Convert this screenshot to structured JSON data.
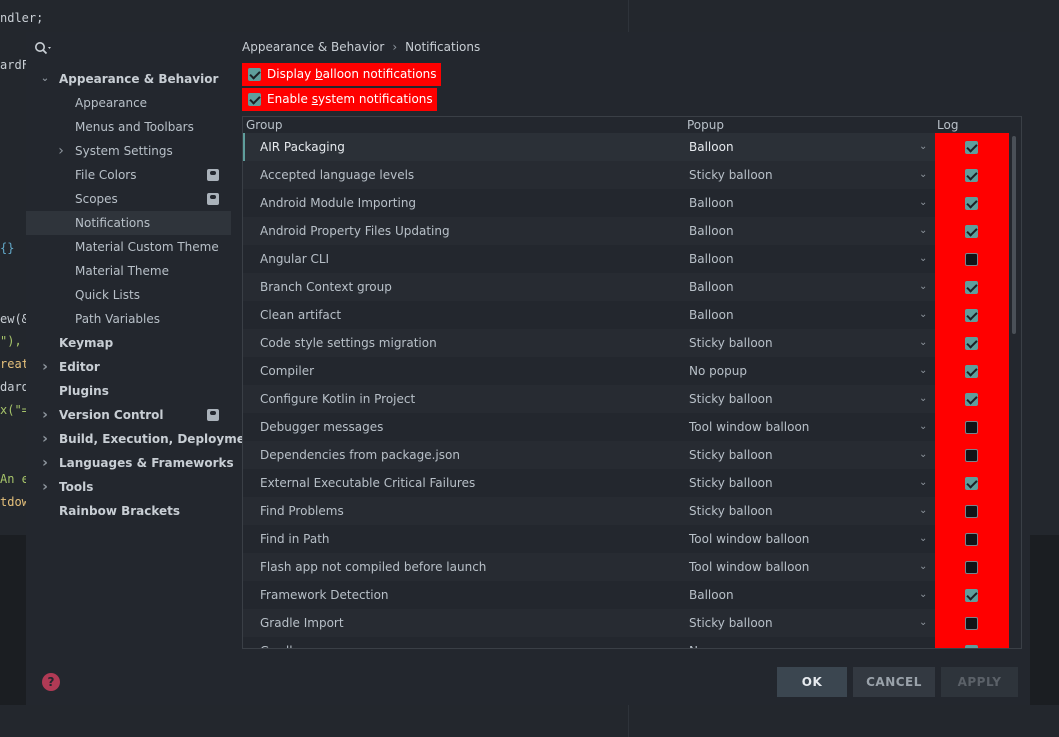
{
  "editor": {
    "lines": [
      {
        "text": "ndler;",
        "color": "#c8ced4"
      },
      {
        "text": "ardF",
        "color": "#c8ced4"
      },
      {
        "text": "{}",
        "color": "#62a8c8"
      },
      {
        "text": "ew(&",
        "color": "#c8ced4"
      },
      {
        "text": "\"),",
        "color": "#a6c46a"
      },
      {
        "text": "reat",
        "color": "#e5c07b"
      },
      {
        "text": "dard",
        "color": "#c8ced4"
      },
      {
        "text": "x(\"=",
        "color": "#a6c46a"
      },
      {
        "text": "An e",
        "color": "#a6c46a"
      },
      {
        "text": "tdow",
        "color": "#e5c07b"
      }
    ]
  },
  "sidebar": {
    "search_icon": "search-icon",
    "items": [
      {
        "label": "Appearance & Behavior",
        "bold": true,
        "arrow": "expanded"
      },
      {
        "label": "Appearance",
        "bold": false
      },
      {
        "label": "Menus and Toolbars",
        "bold": false
      },
      {
        "label": "System Settings",
        "bold": false,
        "arrow": "collapsed"
      },
      {
        "label": "File Colors",
        "bold": false,
        "badge": "profile-icon"
      },
      {
        "label": "Scopes",
        "bold": false,
        "badge": "profile-icon"
      },
      {
        "label": "Notifications",
        "bold": false,
        "selected": true
      },
      {
        "label": "Material Custom Theme",
        "bold": false
      },
      {
        "label": "Material Theme",
        "bold": false
      },
      {
        "label": "Quick Lists",
        "bold": false
      },
      {
        "label": "Path Variables",
        "bold": false
      },
      {
        "label": "Keymap",
        "bold": true
      },
      {
        "label": "Editor",
        "bold": true,
        "arrow": "collapsed"
      },
      {
        "label": "Plugins",
        "bold": true
      },
      {
        "label": "Version Control",
        "bold": true,
        "arrow": "collapsed",
        "badge": "profile-icon"
      },
      {
        "label": "Build, Execution, Deployment",
        "bold": true,
        "arrow": "collapsed"
      },
      {
        "label": "Languages & Frameworks",
        "bold": true,
        "arrow": "collapsed"
      },
      {
        "label": "Tools",
        "bold": true,
        "arrow": "collapsed"
      },
      {
        "label": "Rainbow Brackets",
        "bold": true
      }
    ]
  },
  "breadcrumb": {
    "parent": "Appearance & Behavior",
    "separator": "›",
    "current": "Notifications"
  },
  "options": {
    "balloon": {
      "label_pre": "Display ",
      "label_u": "b",
      "label_post": "alloon notifications",
      "checked": true
    },
    "system": {
      "label_pre": "Enable ",
      "label_u": "s",
      "label_post": "ystem notifications",
      "checked": true
    }
  },
  "table": {
    "headers": {
      "group": "Group",
      "popup": "Popup",
      "log": "Log"
    },
    "rows": [
      {
        "group": "AIR Packaging",
        "popup": "Balloon",
        "log": true
      },
      {
        "group": "Accepted language levels",
        "popup": "Sticky balloon",
        "log": true
      },
      {
        "group": "Android Module Importing",
        "popup": "Balloon",
        "log": true
      },
      {
        "group": "Android Property Files Updating",
        "popup": "Balloon",
        "log": true
      },
      {
        "group": "Angular CLI",
        "popup": "Balloon",
        "log": false
      },
      {
        "group": "Branch Context group",
        "popup": "Balloon",
        "log": true
      },
      {
        "group": "Clean artifact",
        "popup": "Balloon",
        "log": true
      },
      {
        "group": "Code style settings migration",
        "popup": "Sticky balloon",
        "log": true
      },
      {
        "group": "Compiler",
        "popup": "No popup",
        "log": true
      },
      {
        "group": "Configure Kotlin in Project",
        "popup": "Sticky balloon",
        "log": true
      },
      {
        "group": "Debugger messages",
        "popup": "Tool window balloon",
        "log": false
      },
      {
        "group": "Dependencies from package.json",
        "popup": "Sticky balloon",
        "log": false
      },
      {
        "group": "External Executable Critical Failures",
        "popup": "Sticky balloon",
        "log": true
      },
      {
        "group": "Find Problems",
        "popup": "Sticky balloon",
        "log": false
      },
      {
        "group": "Find in Path",
        "popup": "Tool window balloon",
        "log": false
      },
      {
        "group": "Flash app not compiled before launch",
        "popup": "Tool window balloon",
        "log": false
      },
      {
        "group": "Framework Detection",
        "popup": "Balloon",
        "log": true
      },
      {
        "group": "Gradle Import",
        "popup": "Sticky balloon",
        "log": false
      },
      {
        "group": "Gradle",
        "popup": "No popup",
        "log": true
      }
    ]
  },
  "footer": {
    "help_label": "?",
    "ok_label": "OK",
    "cancel_label": "CANCEL",
    "apply_label": "APPLY"
  },
  "colors": {
    "highlight": "#ff0000",
    "accent": "#5f9e9c",
    "background": "#23272e"
  }
}
